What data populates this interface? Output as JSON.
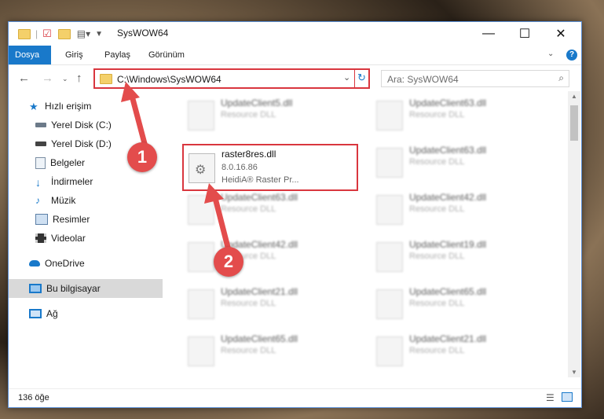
{
  "window": {
    "title": "SysWOW64",
    "controls": {
      "minimize": "—",
      "maximize": "☐",
      "close": "✕"
    },
    "help": "?"
  },
  "ribbon": {
    "tabs": [
      {
        "label": "Dosya",
        "active": true
      },
      {
        "label": "Giriş",
        "active": false
      },
      {
        "label": "Paylaş",
        "active": false
      },
      {
        "label": "Görünüm",
        "active": false
      }
    ]
  },
  "address": {
    "path": "C:\\Windows\\SysWOW64",
    "search_placeholder": "Ara: SysWOW64"
  },
  "sidebar": {
    "items": [
      {
        "label": "Hızlı erişim",
        "icon": "star-icon"
      },
      {
        "label": "Yerel Disk (C:)",
        "icon": "drive-icon",
        "pinned": true
      },
      {
        "label": "Yerel Disk (D:)",
        "icon": "drive-icon",
        "pinned": true
      },
      {
        "label": "Belgeler",
        "icon": "documents-icon",
        "pinned": true
      },
      {
        "label": "İndirmeler",
        "icon": "downloads-icon",
        "pinned": true
      },
      {
        "label": "Müzik",
        "icon": "music-icon",
        "pinned": true
      },
      {
        "label": "Resimler",
        "icon": "pictures-icon",
        "pinned": true
      },
      {
        "label": "Videolar",
        "icon": "videos-icon",
        "pinned": true
      },
      {
        "label": "OneDrive",
        "icon": "cloud-icon"
      },
      {
        "label": "Bu bilgisayar",
        "icon": "computer-icon",
        "selected": true
      },
      {
        "label": "Ağ",
        "icon": "network-icon"
      }
    ]
  },
  "files": {
    "highlighted": {
      "name": "raster8res.dll",
      "version": "8.0.16.86",
      "description": "HeidiA® Raster Pr..."
    },
    "left_column": [
      {
        "name": "UpdateClient5.dll",
        "desc": "Resource DLL"
      },
      {
        "name": "UpdateClient63.dll",
        "desc": "Resource DLL"
      },
      {
        "name": "UpdateClient42.dll",
        "desc": "Resource DLL"
      },
      {
        "name": "UpdateClient21.dll",
        "desc": "Resource DLL"
      },
      {
        "name": "UpdateClient65.dll",
        "desc": "Resource DLL"
      }
    ],
    "right_column": [
      {
        "name": "UpdateClient63.dll",
        "desc": "Resource DLL"
      },
      {
        "name": "UpdateClient63.dll",
        "desc": "Resource DLL"
      },
      {
        "name": "UpdateClient42.dll",
        "desc": "Resource DLL"
      },
      {
        "name": "UpdateClient19.dll",
        "desc": "Resource DLL"
      },
      {
        "name": "UpdateClient65.dll",
        "desc": "Resource DLL"
      },
      {
        "name": "UpdateClient21.dll",
        "desc": "Resource DLL"
      }
    ]
  },
  "status": {
    "count": "136 öğe"
  },
  "annotations": [
    {
      "label": "1"
    },
    {
      "label": "2"
    }
  ],
  "colors": {
    "accent": "#1979ca",
    "highlight": "#d9363e",
    "annotation": "#e34c4c"
  }
}
